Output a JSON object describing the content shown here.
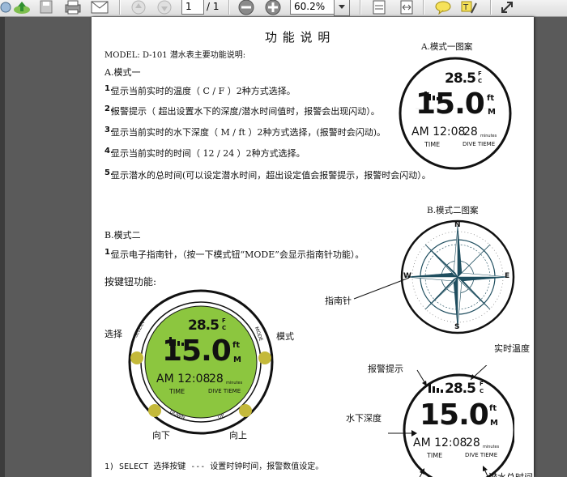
{
  "toolbar": {
    "page_current": "1",
    "page_total": "/ 1",
    "zoom": "60.2%"
  },
  "doc": {
    "title": "功 能 说 明",
    "model_intro": "MODEL: D-101 潜水表主要功能说明:",
    "mode1_heading": "A.模式一",
    "mode1_items": [
      {
        "num": "1.",
        "text": "显示当前实时的温度（ C / F ）2种方式选择。"
      },
      {
        "num": "2.",
        "text": "报警提示（ 超出设置水下的深度/潜水时间值时，报警会出现闪动）。"
      },
      {
        "num": "3.",
        "text": "显示当前实时的水下深度（ M / ft ）2种方式选择，(报警时会闪动)。"
      },
      {
        "num": "4.",
        "text": "显示当前实时的时间（ 12 / 24 ）2种方式选择。"
      },
      {
        "num": "5.",
        "text": "显示潜水的总时间(可以设定潜水时间，超出设定值会报警提示，报警时会闪动）。"
      }
    ],
    "mode2_heading": "B.模式二",
    "mode2_item": {
      "num": "1.",
      "text": "显示电子指南针，（按一下模式钮“MODE”会显示指南针功能）。"
    },
    "buttons_heading": "按键钮功能:",
    "footer_line": "1) SELECT 选择按键 --- 设置时钟时间，报警数值设定。",
    "fig_a_caption": "A.模式一图案",
    "fig_b_caption": "B.模式二图案",
    "compass_label": "指南针",
    "compass": {
      "n": "N",
      "s": "S",
      "e": "E",
      "w": "W"
    },
    "labels": {
      "select": "选择",
      "mode": "模式",
      "down": "向下",
      "up": "向上",
      "realtime_temp": "实时温度",
      "alarm": "报警提示",
      "depth": "水下深度",
      "dive_total": "潜水总时间"
    },
    "button_names": {
      "select": "SELECT",
      "mode": "MODE",
      "down": "DOWN",
      "up": "UP"
    }
  },
  "watch": {
    "temp": "28.5",
    "temp_unit_top": "F",
    "temp_unit_bottom": "C",
    "depth": "15.0",
    "depth_unit_top": "ft",
    "depth_unit_bottom": "M",
    "time": "AM 12:08",
    "time_label": "TIME",
    "dive": "28",
    "dive_unit": "minutes",
    "dive_label": "DIVE TIEME"
  },
  "colors": {
    "watch_green": "#8cc63f",
    "button_olive": "#c4b93a",
    "compass_teal": "#1f4e5f"
  }
}
